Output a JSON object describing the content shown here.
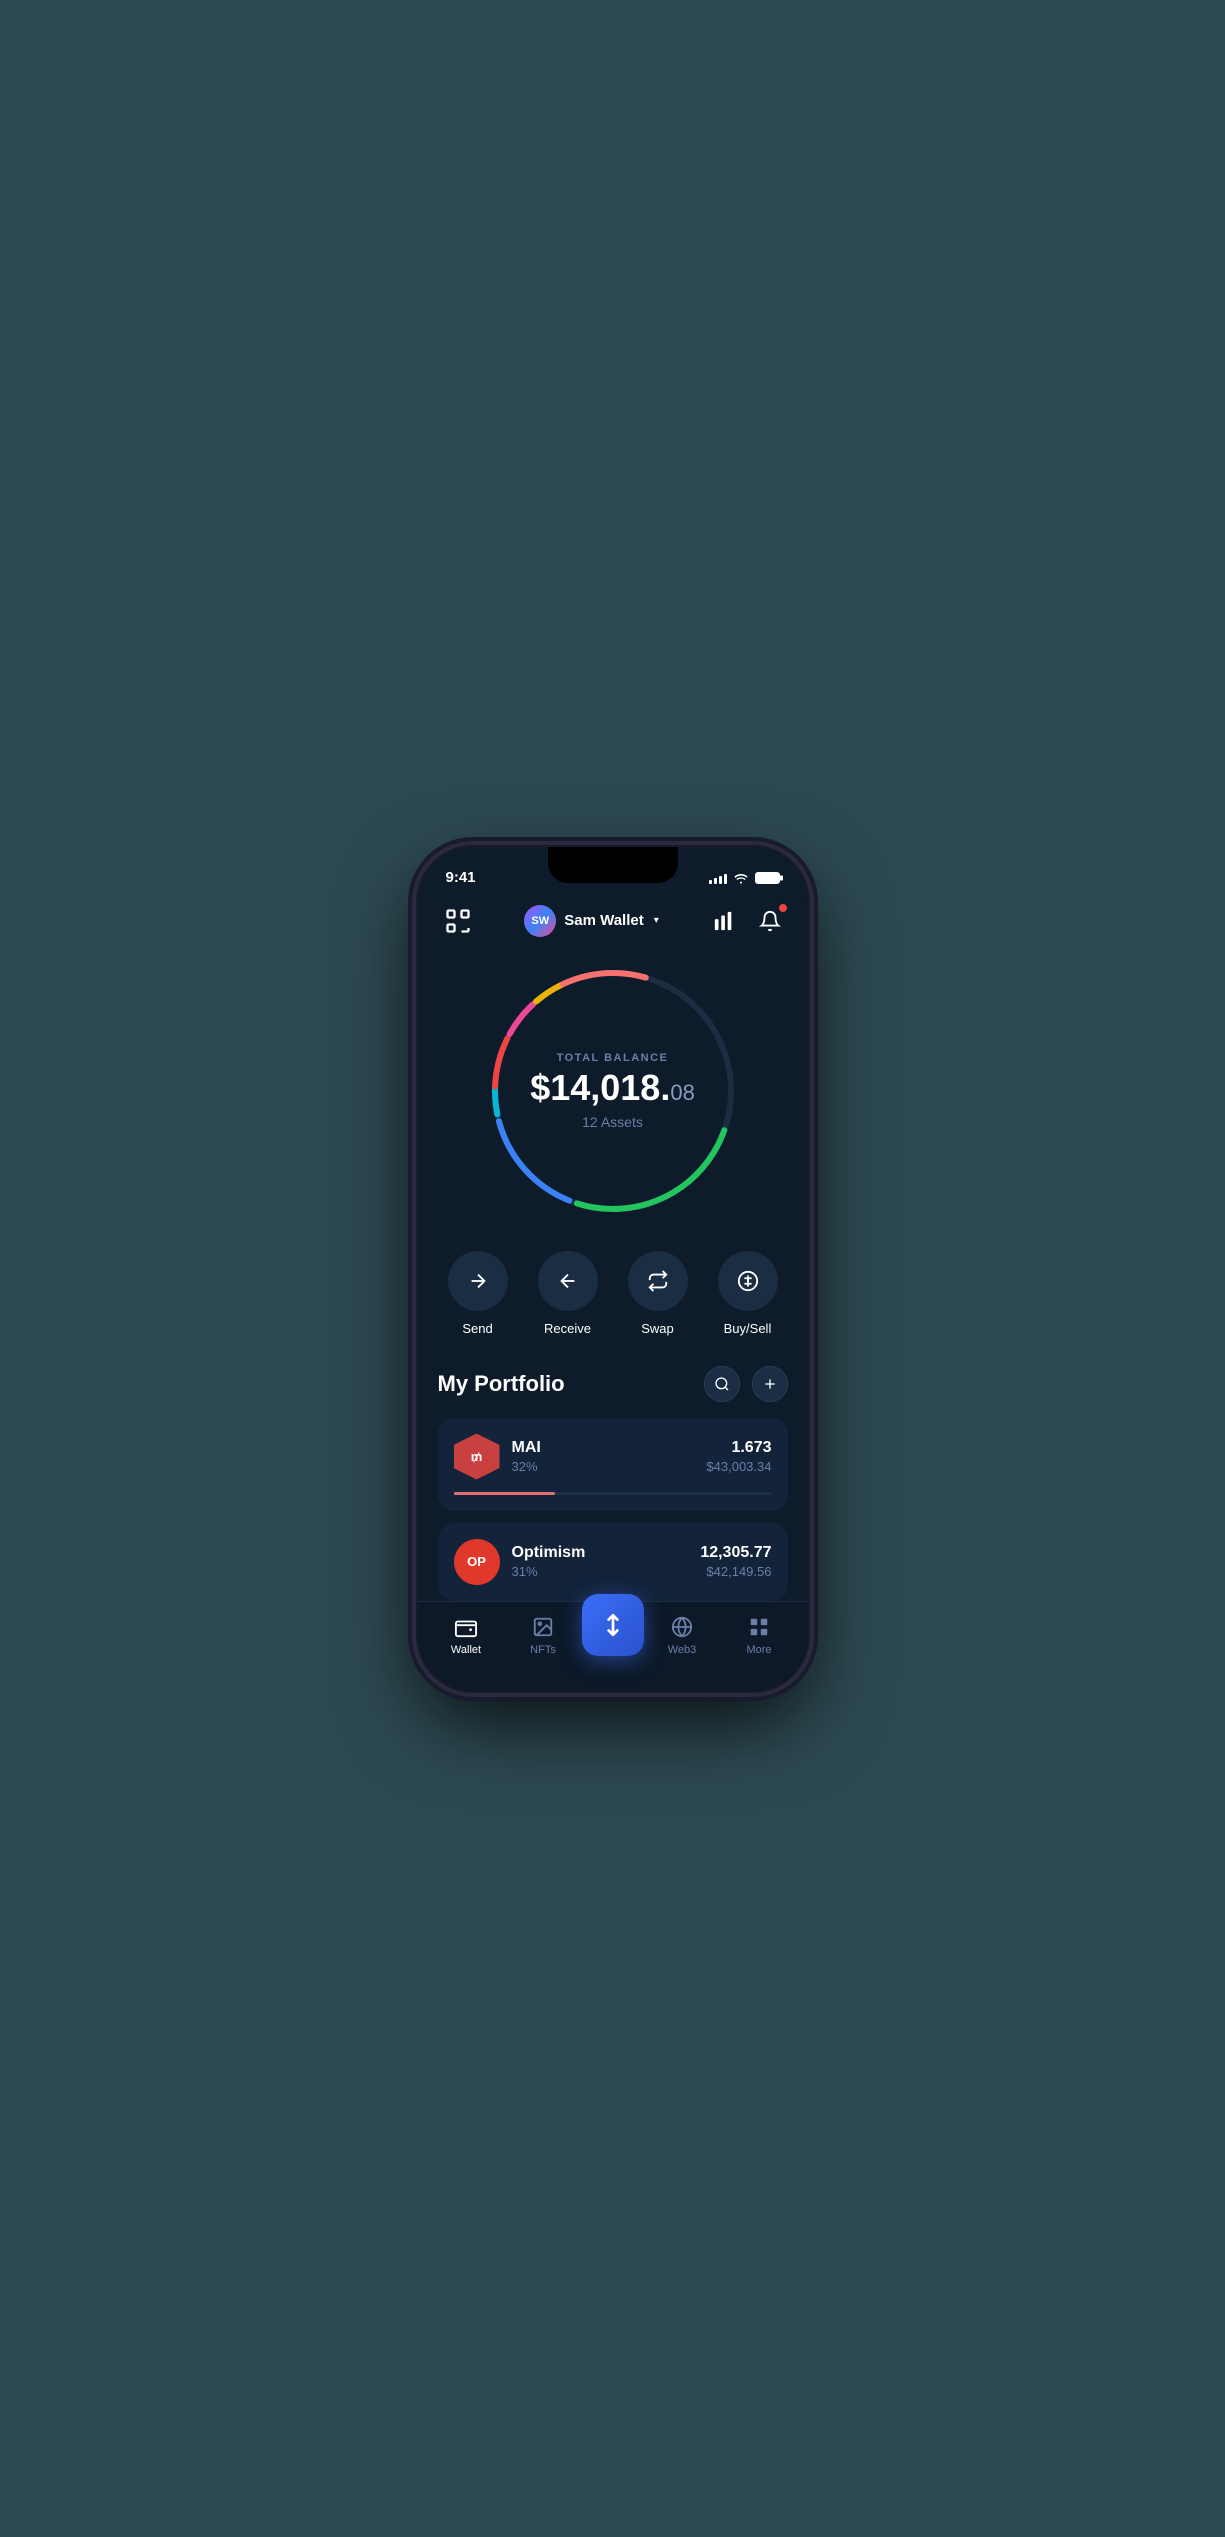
{
  "status_bar": {
    "time": "9:41",
    "signal_bars": 4,
    "wifi": true,
    "battery": "full"
  },
  "header": {
    "scan_label": "scan",
    "wallet_initials": "SW",
    "wallet_name": "Sam Wallet",
    "chart_label": "chart",
    "bell_label": "notifications"
  },
  "balance": {
    "label": "TOTAL BALANCE",
    "main": "$14,018.",
    "cents": "08",
    "assets_count": "12 Assets"
  },
  "actions": [
    {
      "id": "send",
      "label": "Send",
      "icon": "arrow-right"
    },
    {
      "id": "receive",
      "label": "Receive",
      "icon": "arrow-left"
    },
    {
      "id": "swap",
      "label": "Swap",
      "icon": "swap"
    },
    {
      "id": "buysell",
      "label": "Buy/Sell",
      "icon": "dollar-circle"
    }
  ],
  "portfolio": {
    "title": "My Portfolio",
    "search_label": "search",
    "add_label": "add"
  },
  "assets": [
    {
      "id": "mai",
      "name": "MAI",
      "symbol": "M",
      "pct": "32%",
      "amount": "1.673",
      "usd": "$43,003.34",
      "progress": 32,
      "color": "#e07070",
      "icon_bg": "#c94040",
      "icon_type": "hex"
    },
    {
      "id": "op",
      "name": "Optimism",
      "symbol": "OP",
      "pct": "31%",
      "amount": "12,305.77",
      "usd": "$42,149.56",
      "progress": 31,
      "color": "#e07070",
      "icon_bg": "#e0392b",
      "icon_type": "circle"
    }
  ],
  "nav": {
    "items": [
      {
        "id": "wallet",
        "label": "Wallet",
        "active": true
      },
      {
        "id": "nfts",
        "label": "NFTs",
        "active": false
      },
      {
        "id": "center",
        "label": "",
        "active": false
      },
      {
        "id": "web3",
        "label": "Web3",
        "active": false
      },
      {
        "id": "more",
        "label": "More",
        "active": false
      }
    ]
  }
}
